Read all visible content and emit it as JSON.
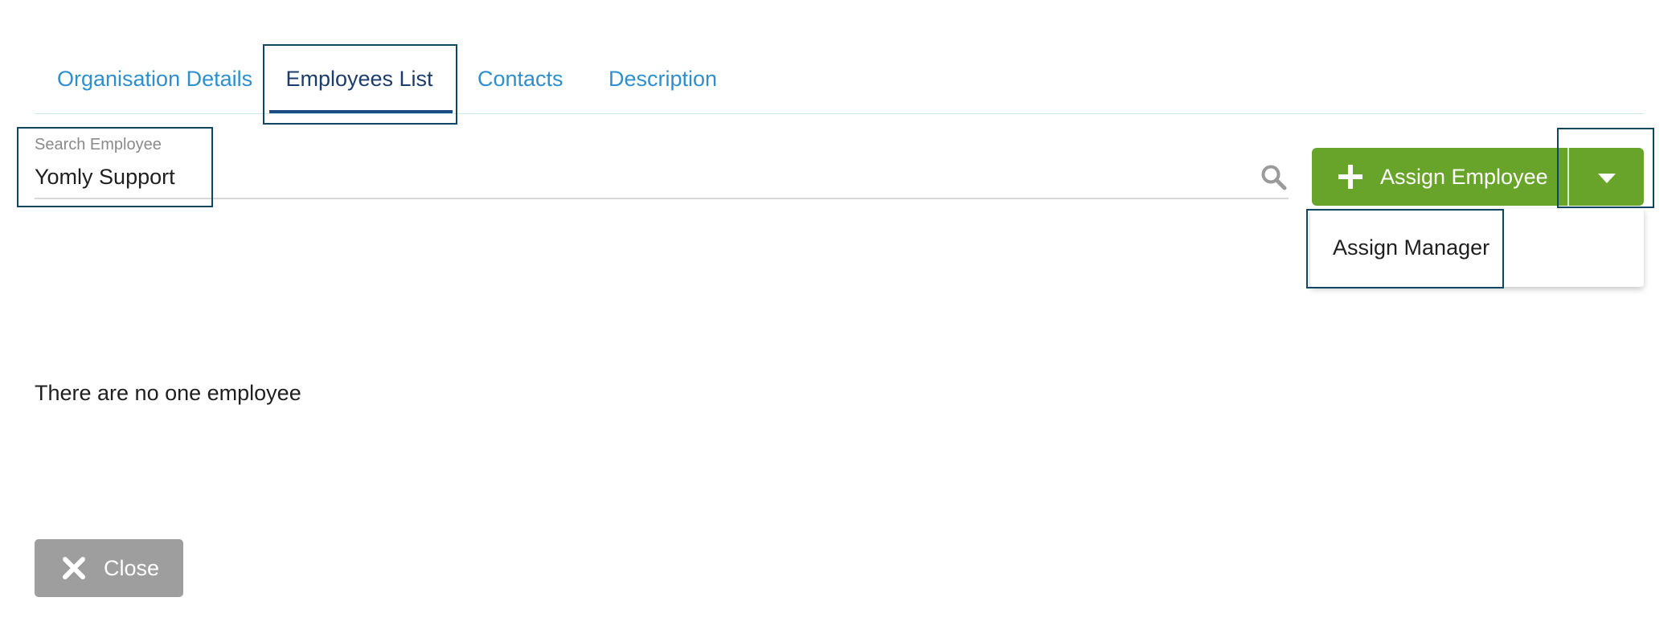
{
  "tabs": [
    {
      "label": "Organisation Details",
      "active": false
    },
    {
      "label": "Employees List",
      "active": true
    },
    {
      "label": "Contacts",
      "active": false
    },
    {
      "label": "Description",
      "active": false
    }
  ],
  "search": {
    "label": "Search Employee",
    "value": "Yomly Support",
    "icon": "search-icon"
  },
  "actions": {
    "assign_label": "Assign Employee",
    "assign_icon": "plus-icon",
    "dropdown_icon": "caret-down-icon",
    "dropdown_items": [
      "Assign Manager"
    ]
  },
  "empty_message": "There are no one employee",
  "footer": {
    "close_label": "Close",
    "close_icon": "close-icon"
  },
  "colors": {
    "tab_link": "#2e8fcf",
    "tab_active": "#1b3d6e",
    "primary_green": "#68a42a",
    "close_grey": "#9e9e9e",
    "highlight_border": "#0f4761"
  }
}
